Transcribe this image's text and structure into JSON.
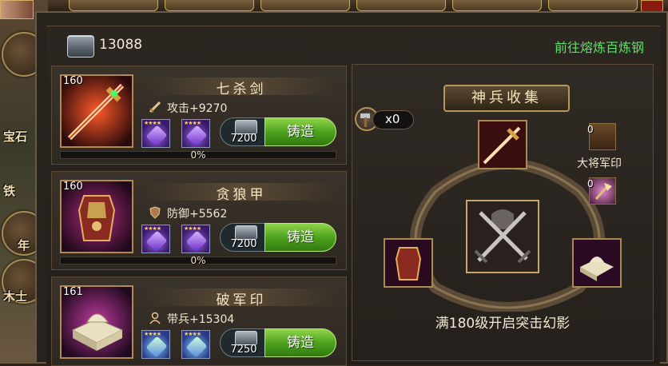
{
  "side": {
    "labels": [
      "宝石",
      "铁",
      "年",
      "木士"
    ]
  },
  "header": {
    "steel_count": "13088",
    "goto_link": "前往熔炼百炼钢"
  },
  "cards": [
    {
      "level": "160",
      "name": "七杀剑",
      "stat_icon": "sword-icon",
      "stat": "攻击+9270",
      "cost": "7200",
      "forge": "铸造",
      "progress_pct": "0%",
      "progress_value": 0
    },
    {
      "level": "160",
      "name": "贪狼甲",
      "stat_icon": "shield-icon",
      "stat": "防御+5562",
      "cost": "7200",
      "forge": "铸造",
      "progress_pct": "0%",
      "progress_value": 0
    },
    {
      "level": "161",
      "name": "破军印",
      "stat_icon": "soldier-icon",
      "stat": "带兵+15304",
      "cost": "7250",
      "forge": "铸造",
      "progress_pct": "",
      "progress_value": 0
    }
  ],
  "collection": {
    "title": "神兵收集",
    "hammer_count": "x0",
    "seal_count": "0",
    "seal_label": "大将军印",
    "axe_count": "0",
    "unlock_text": "满180级开启突击幻影"
  },
  "colors": {
    "accent_green": "#5fe06a",
    "button_green": "#4fa21e",
    "frame_gold": "#b28a4f"
  }
}
